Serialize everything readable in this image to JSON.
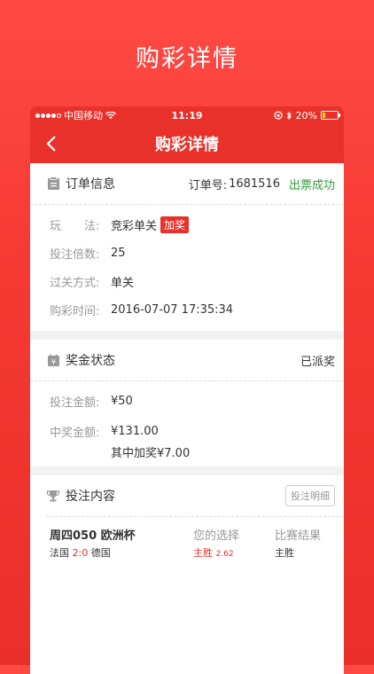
{
  "promo_title": "购彩详情",
  "status_bar": {
    "carrier": "中国移动",
    "time": "11:19",
    "battery": "20%",
    "battery_level": 0.2
  },
  "nav": {
    "title": "购彩详情"
  },
  "order": {
    "title": "订单信息",
    "order_label": "订单号:",
    "order_no": "1681516",
    "status": "出票成功",
    "rows": [
      {
        "label": "玩　　法:",
        "value": "竞彩单关",
        "tag": "加奖"
      },
      {
        "label": "投注倍数:",
        "value": "25"
      },
      {
        "label": "过关方式:",
        "value": "单关"
      },
      {
        "label": "购彩时间:",
        "value": "2016-07-07 17:35:34"
      }
    ]
  },
  "prize": {
    "title": "奖金状态",
    "status": "已派奖",
    "bet_label": "投注金额:",
    "bet_amount": "¥50",
    "win_label": "中奖金额:",
    "win_amount": "¥131.00",
    "bonus_note": "其中加奖¥7.00"
  },
  "bet": {
    "title": "投注内容",
    "detail_button": "投注明细",
    "col_match": "周四050 欧洲杯",
    "col_choice": "您的选择",
    "col_result": "比赛结果",
    "home": "法国",
    "score": "2:0",
    "away": "德国",
    "choice": "主胜",
    "odds": "2.62",
    "result": "主胜"
  }
}
